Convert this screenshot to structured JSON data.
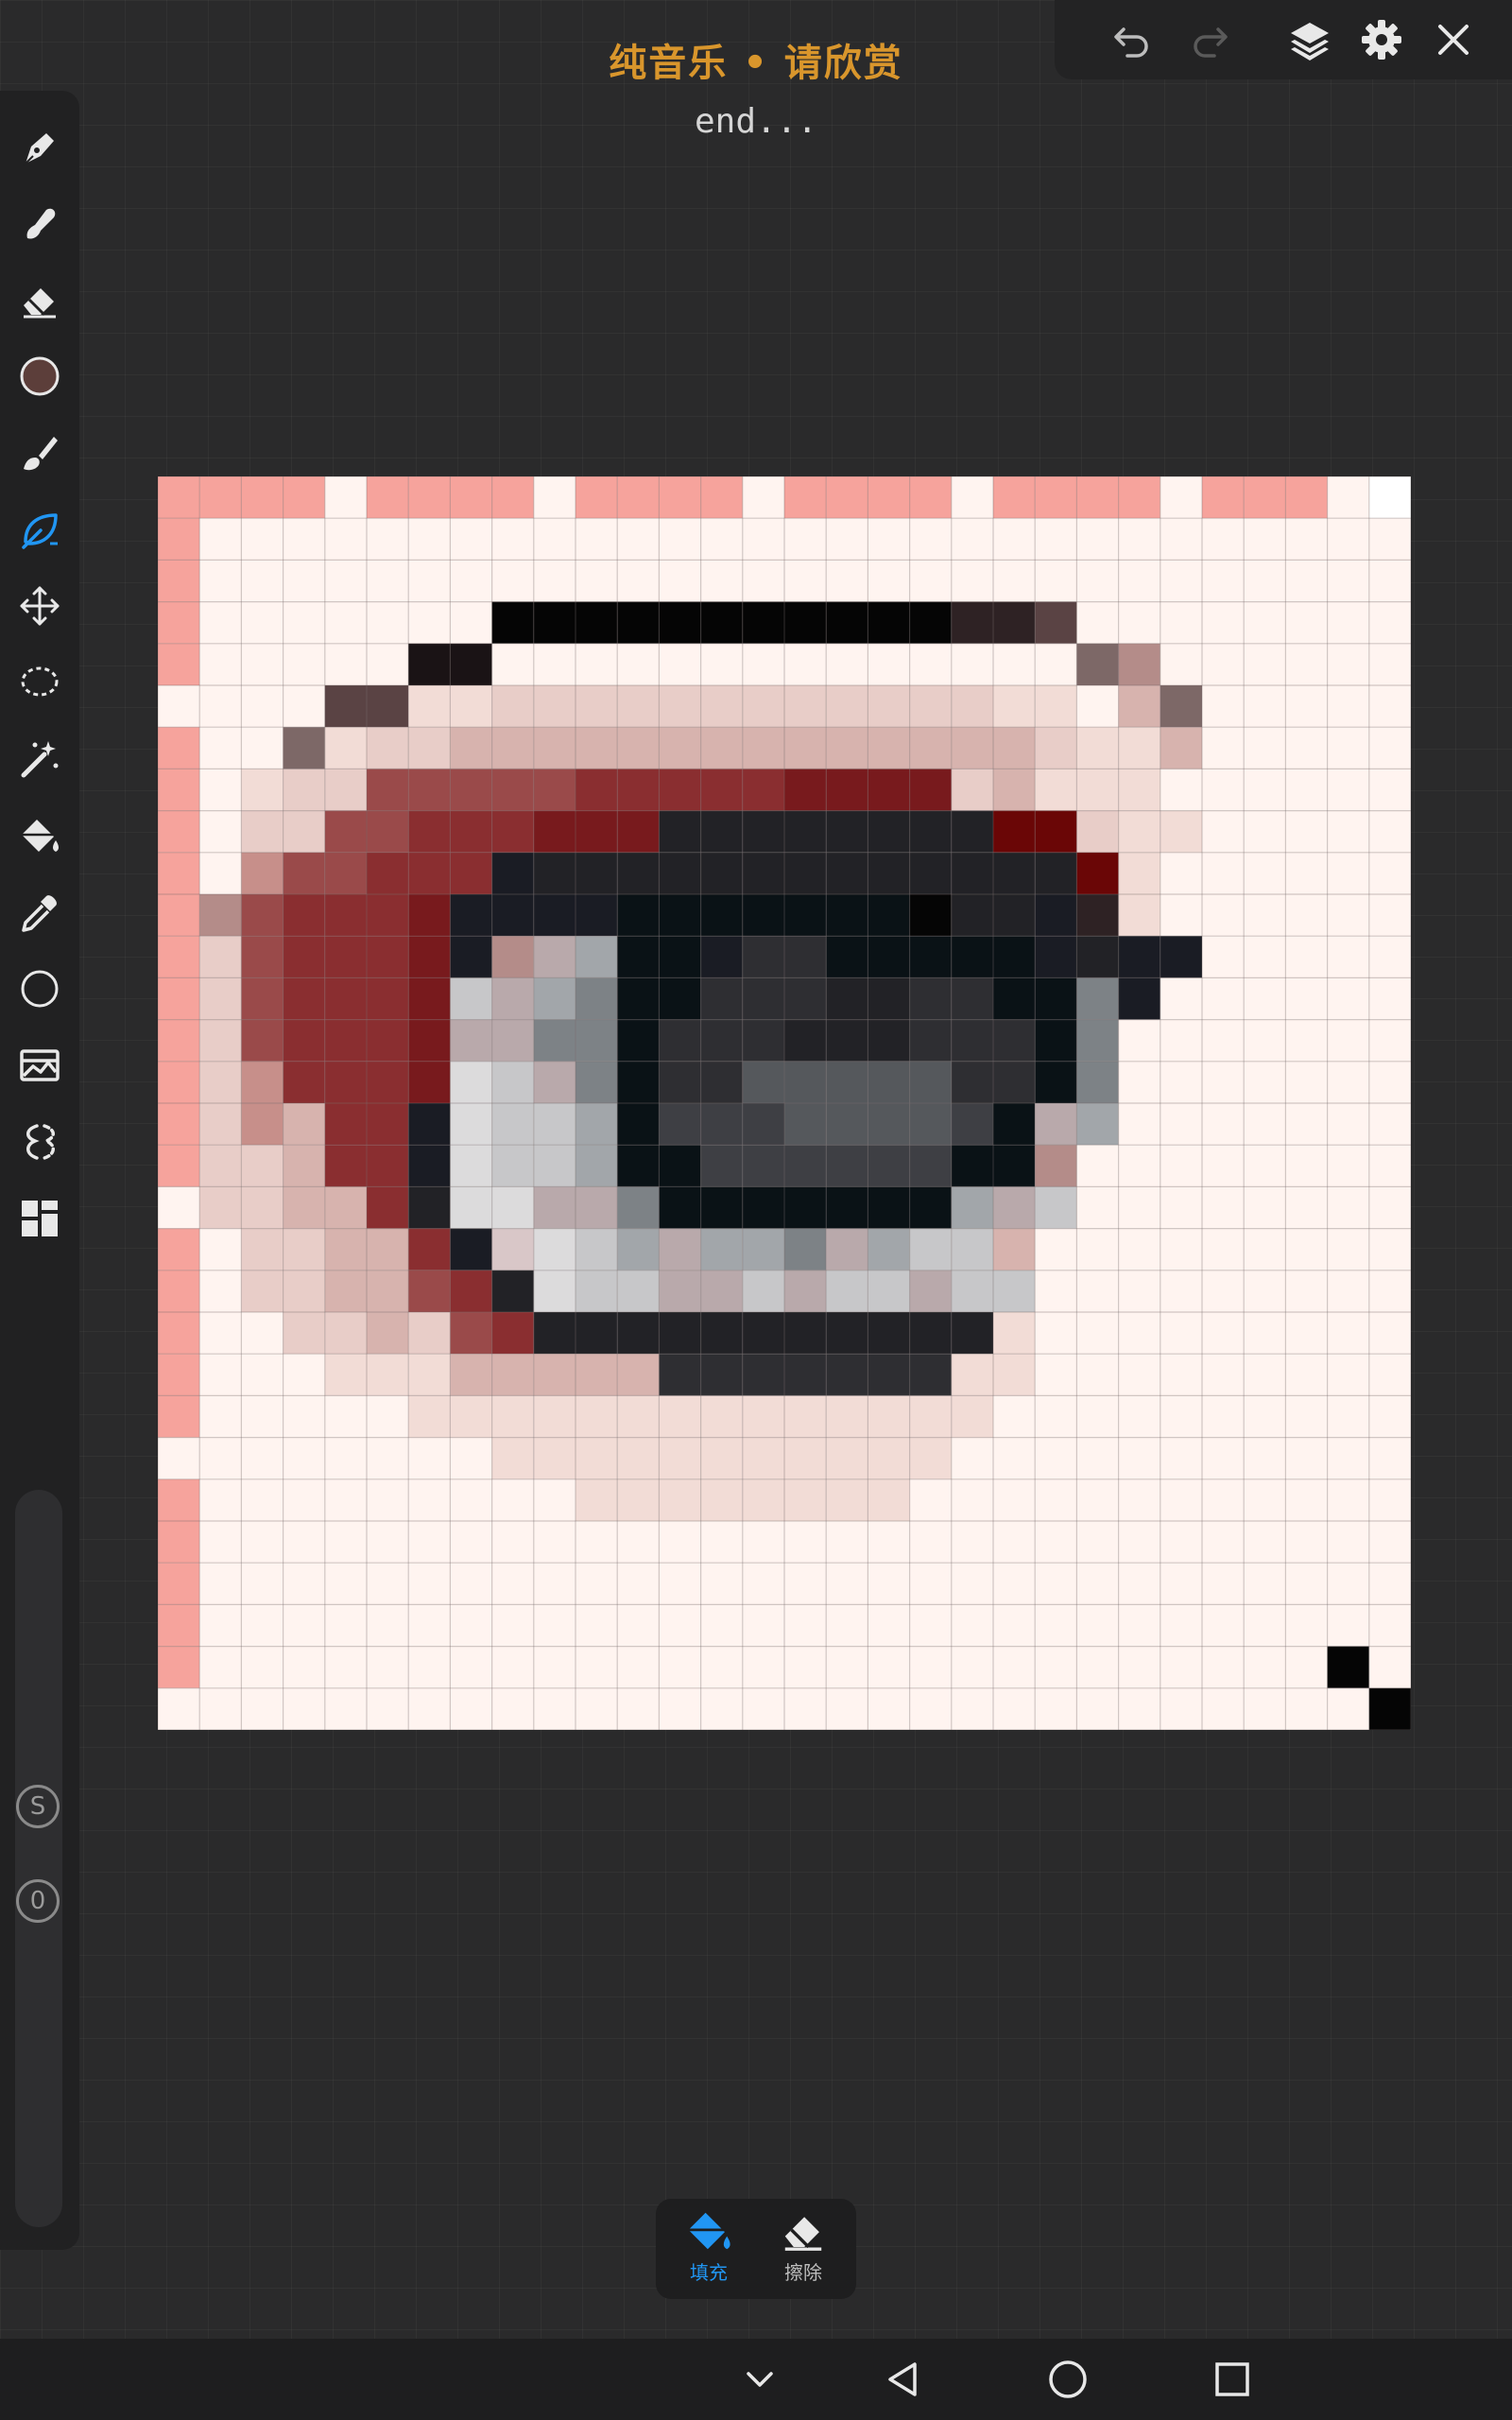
{
  "header": {
    "title": "纯音乐 • 请欣赏",
    "subtitle": "end..."
  },
  "colors": {
    "accent_blue": "#2196f3",
    "title_gold": "#d9962c",
    "current_color": "#5c3e3a",
    "icon_grey": "#e8e8e8"
  },
  "topbar": {
    "icons": [
      "undo-icon",
      "redo-icon",
      "layers-icon",
      "gear-icon",
      "close-icon"
    ]
  },
  "toolbar": {
    "tools": [
      "pen-icon",
      "smudge-icon",
      "eraser-icon",
      "color-swatch",
      "brush-icon",
      "leaf-icon",
      "move-icon",
      "lasso-icon",
      "magic-wand-icon",
      "paint-bucket-icon",
      "eyedropper-icon",
      "shape-circle-icon",
      "image-import-icon",
      "symmetry-icon",
      "grid-apps-icon"
    ],
    "selected_tool": "leaf-icon",
    "badge_s": "S",
    "badge_o": "0"
  },
  "bottom_popup": {
    "fill_label": "填充",
    "erase_label": "擦除"
  },
  "navbar": {
    "icons": [
      "chevron-down-icon",
      "back-icon",
      "home-icon",
      "recents-icon"
    ]
  },
  "pixel_art": {
    "size": 30,
    "palette": {
      "B": "#fff4f0",
      "W": "#ffffff",
      "P": "#f6a39c",
      "K": "#050505",
      "k": "#1a1315",
      "d": "#2e2224",
      "m": "#5a4344",
      "g": "#7d6867",
      "q": "#b48c89",
      "l": "#e8cdc8",
      "L": "#f2dcd6",
      "t": "#d7b3ae",
      "u": "#c78f8a",
      "r": "#9a4a4a",
      "R": "#8a2e30",
      "x": "#781a1d",
      "X": "#6a0606",
      "N": "#222226",
      "n": "#2e2e32",
      "s": "#1a1c24",
      "D": "#0a1216",
      "e": "#3e3f44",
      "f": "#55585c",
      "h": "#7d8286",
      "a": "#a2a6aa",
      "c": "#c7c7c9",
      "w": "#dcdbdc",
      "v": "#b9a9ab",
      "Y": "#d9c7c8"
    },
    "rows": [
      "PPPPBPPPPBPPPPBPPPPBPPPPBPPPBW",
      "PBBBBBBBBBBBBBBBBBBBBBBBBBBBBB",
      "PBBBBBBBBBBBBBBBBBBBBBBBBBBBBB",
      "PBBBBBBBKKKKKKKKKKKddmBBBBBBBB",
      "PBBBBBkkBBBBBBBBBBBBBBgqBBBBBB",
      "BBBBmmLLllllllllllllLLBtgBBBBB",
      "PBBgLllttttttttttttttlLLtBBBBB",
      "PBLllrrrrrRRRRRxxxxltLLLBBBBBB",
      "PBllrrRRRxxxNNNNNNNNXXlLLBBBBB",
      "PBurrRRRsNNNNNNNNNNNNNXLBBBBBB",
      "PqrRRRxssssDDDDDDDKNNsdLBBBBBB",
      "PlrRRRxsqvaDDsnnDDDDDsNssBBBBB",
      "PlrRRRxcvahDDnnnNNnnDDhsBBBBBB",
      "PlrRRRxvvhhDnnnNNNnnnDhBBBBBBB",
      "PluRRRxwcvhDnnfffffnnDhBBBBBBB",
      "PlutRRswccaDeeeffffeDvaBBBBBBB",
      "PlltRRswccaDDeeeeeeDDqBBBBBBBB",
      "BllttRNwwvvhDDDDDDDavcBBBBBBBB",
      "PBllttRsYwcavaahvacctBBBBBBBBB",
      "PBllttrRNwccvvcvccvccBBBBBBBBB",
      "PBBlltlrRNNNNNNNNNNNLBBBBBBBBB",
      "PBBBLLLtttttnnnnnnnLLBBBBBBBBB",
      "PBBBBBLLLLLLLLLLLLLLBBBBBBBBBB",
      "BBBBBBBBLLLLLLLLLLLBBBBBBBBBBB",
      "PBBBBBBBBBLLLLLLLLBBBBBBBBBBBB",
      "PBBBBBBBBBBBBBBBBBBBBBBBBBBBBB",
      "PBBBBBBBBBBBBBBBBBBBBBBBBBBBBB",
      "PBBBBBBBBBBBBBBBBBBBBBBBBBBBBB",
      "PBBBBBBBBBBBBBBBBBBBBBBBBBBBKB",
      "BBBBBBBBBBBBBBBBBBBBBBBBBBBBBK"
    ]
  }
}
